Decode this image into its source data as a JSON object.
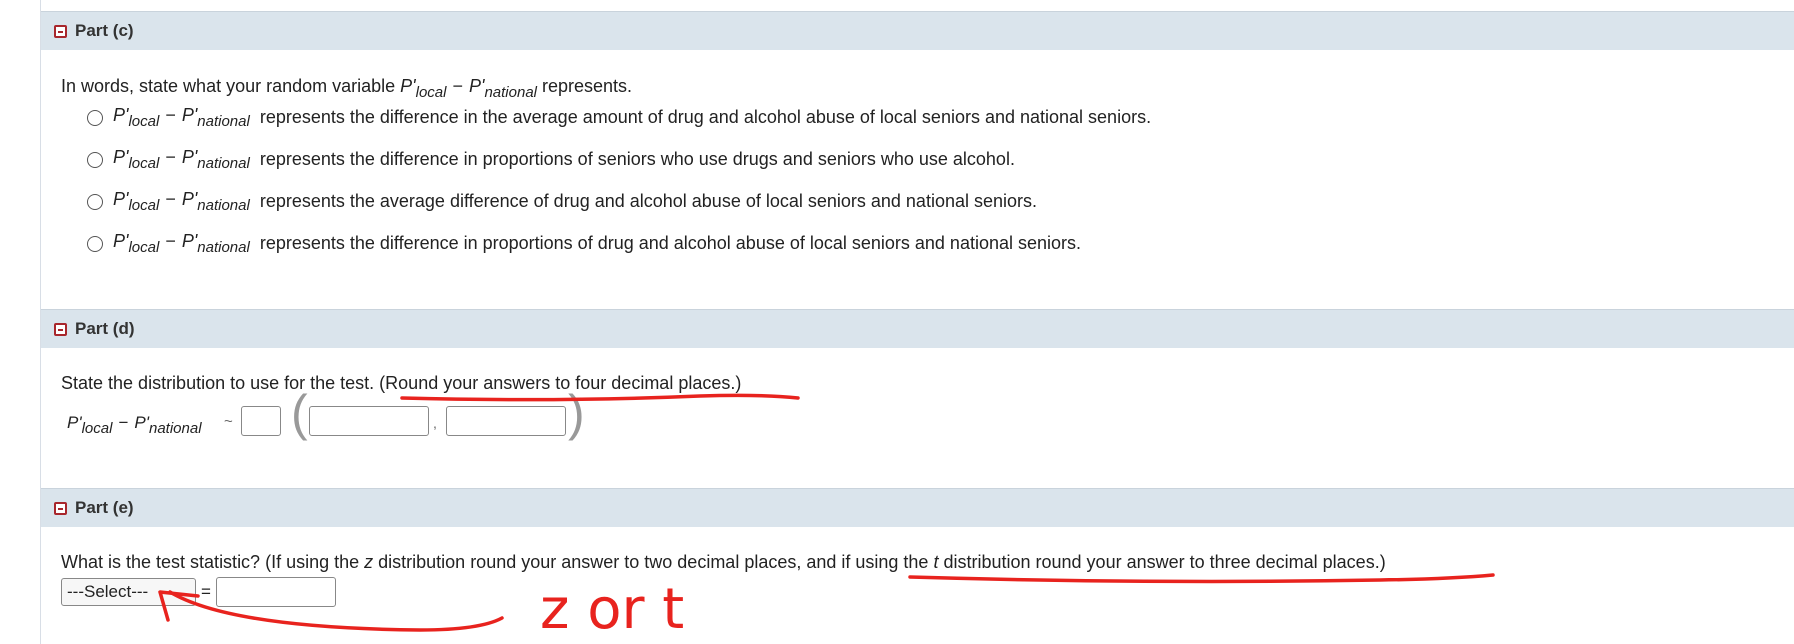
{
  "part_c": {
    "title": "Part (c)",
    "prompt_before": "In words, state what your random variable ",
    "prompt_after": " represents.",
    "options": [
      {
        "text": "represents the difference in the average amount of drug and alcohol abuse of local seniors and national seniors."
      },
      {
        "text": "represents the difference in proportions of seniors who use drugs and seniors who use alcohol."
      },
      {
        "text": "represents the average difference of drug and alcohol abuse of local seniors and national seniors."
      },
      {
        "text": "represents the difference in proportions of drug and alcohol abuse of local seniors and national seniors."
      }
    ]
  },
  "variable": {
    "p": "P'",
    "local": "local",
    "national": "national",
    "minus": "−"
  },
  "part_d": {
    "title": "Part (d)",
    "prompt": "State the distribution to use for the test. (Round your answers to four decimal places.)",
    "tilde": "~",
    "comma": ","
  },
  "part_e": {
    "title": "Part (e)",
    "prompt_1": "What is the test statistic? (If using the ",
    "z": "z",
    "prompt_2": " distribution round your answer to two decimal places, and if using the ",
    "t": "t",
    "prompt_3": " distribution round your answer to three decimal places.)",
    "select_value": "---Select---",
    "equals": "="
  },
  "annotation": {
    "handwriting": "z or t",
    "ink_color": "#e8231e"
  }
}
